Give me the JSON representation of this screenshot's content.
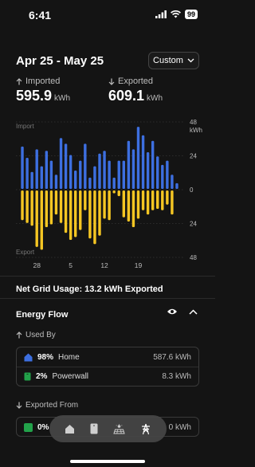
{
  "status": {
    "time": "6:41",
    "battery": "99"
  },
  "header": {
    "date_range": "Apr 25 - May 25",
    "custom_label": "Custom"
  },
  "stats": {
    "imported": {
      "label": "Imported",
      "value": "595.9",
      "unit": "kWh"
    },
    "exported": {
      "label": "Exported",
      "value": "609.1",
      "unit": "kWh"
    }
  },
  "chart_data": {
    "type": "bar",
    "series": [
      {
        "name": "Import",
        "color": "#3d6fe0",
        "values": [
          30,
          22,
          12,
          28,
          16,
          27,
          20,
          10,
          36,
          32,
          24,
          13,
          20,
          32,
          8,
          16,
          25,
          27,
          20,
          8,
          20,
          20,
          34,
          28,
          44,
          38,
          26,
          34,
          23,
          17,
          20,
          10,
          4
        ]
      },
      {
        "name": "Export",
        "color": "#f5c623",
        "values": [
          -21,
          -23,
          -25,
          -40,
          -42,
          -26,
          -24,
          -17,
          -23,
          -30,
          -35,
          -33,
          -28,
          -14,
          -34,
          -38,
          -32,
          -20,
          -21,
          -2,
          -4,
          -19,
          -22,
          -26,
          -20,
          -14,
          -17,
          -14,
          -13,
          -14,
          -10,
          -17,
          0
        ]
      }
    ],
    "x_tick_labels": [
      "28",
      "5",
      "12",
      "19"
    ],
    "y_ticks": [
      48,
      24,
      0,
      24,
      48
    ],
    "y_unit": "kWh",
    "y_range": [
      -48,
      48
    ],
    "region_labels": {
      "top": "Import",
      "bottom": "Export"
    }
  },
  "net_usage": "Net Grid Usage: 13.2 kWh Exported",
  "energy_flow": {
    "title": "Energy Flow",
    "used_by_label": "Used By",
    "used_by": [
      {
        "pct": "98%",
        "name": "Home",
        "value": "587.6 kWh",
        "color": "#3d6fe0"
      },
      {
        "pct": "2%",
        "name": "Powerwall",
        "value": "8.3 kWh",
        "color": "#22a24a"
      }
    ],
    "exported_from_label": "Exported From",
    "exported_from": [
      {
        "pct": "0%",
        "value": "0 kWh"
      }
    ]
  },
  "colors": {
    "import": "#3d6fe0",
    "export": "#f5c623",
    "background": "#141414"
  }
}
